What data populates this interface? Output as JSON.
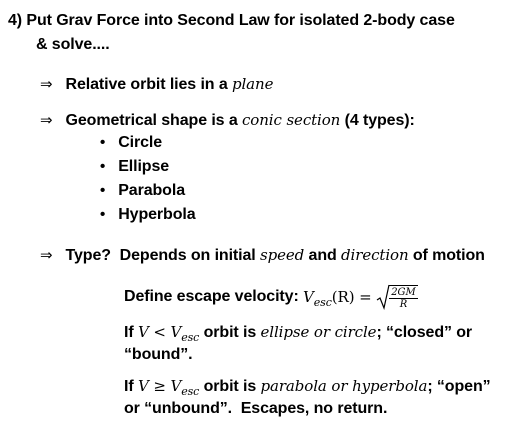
{
  "heading": {
    "line1": "4) Put Grav Force into Second Law for isolated 2-body case",
    "line2": "& solve...."
  },
  "point1": {
    "arrow": "⇒",
    "text": "Relative orbit lies in a",
    "italic": "plane"
  },
  "point2": {
    "arrow": "⇒",
    "text_before": "Geometrical shape is a",
    "italic": "conic section",
    "text_after": "(4 types):",
    "bullets": [
      "Circle",
      "Ellipse",
      "Parabola",
      "Hyperbola"
    ]
  },
  "point3": {
    "arrow": "⇒",
    "type_label": "Type?",
    "text1": "Depends on initial",
    "italic1": "speed",
    "and": "and",
    "italic2": "direction",
    "text2": "of motion"
  },
  "escape": {
    "label": "Define escape velocity:",
    "lhs": "V",
    "lhs_sub": "esc",
    "arg": "(R) =",
    "numerator": "2GM",
    "denominator": "R"
  },
  "case1": {
    "if": "If",
    "condition_v": "V",
    "condition_op": "<",
    "condition_vesc": "V",
    "condition_sub": "esc",
    "orbit_is": "orbit is",
    "italic": "ellipse or circle",
    "rest_line1": "; “closed” or",
    "line2": "“bound”."
  },
  "case2": {
    "if": "If",
    "condition_v": "V",
    "condition_op": "≥",
    "condition_vesc": "V",
    "condition_sub": "esc",
    "orbit_is": "orbit is",
    "italic": "parabola or hyperbola",
    "rest_line1": "; “open”",
    "line2": "or “unbound”.  Escapes, no return."
  }
}
